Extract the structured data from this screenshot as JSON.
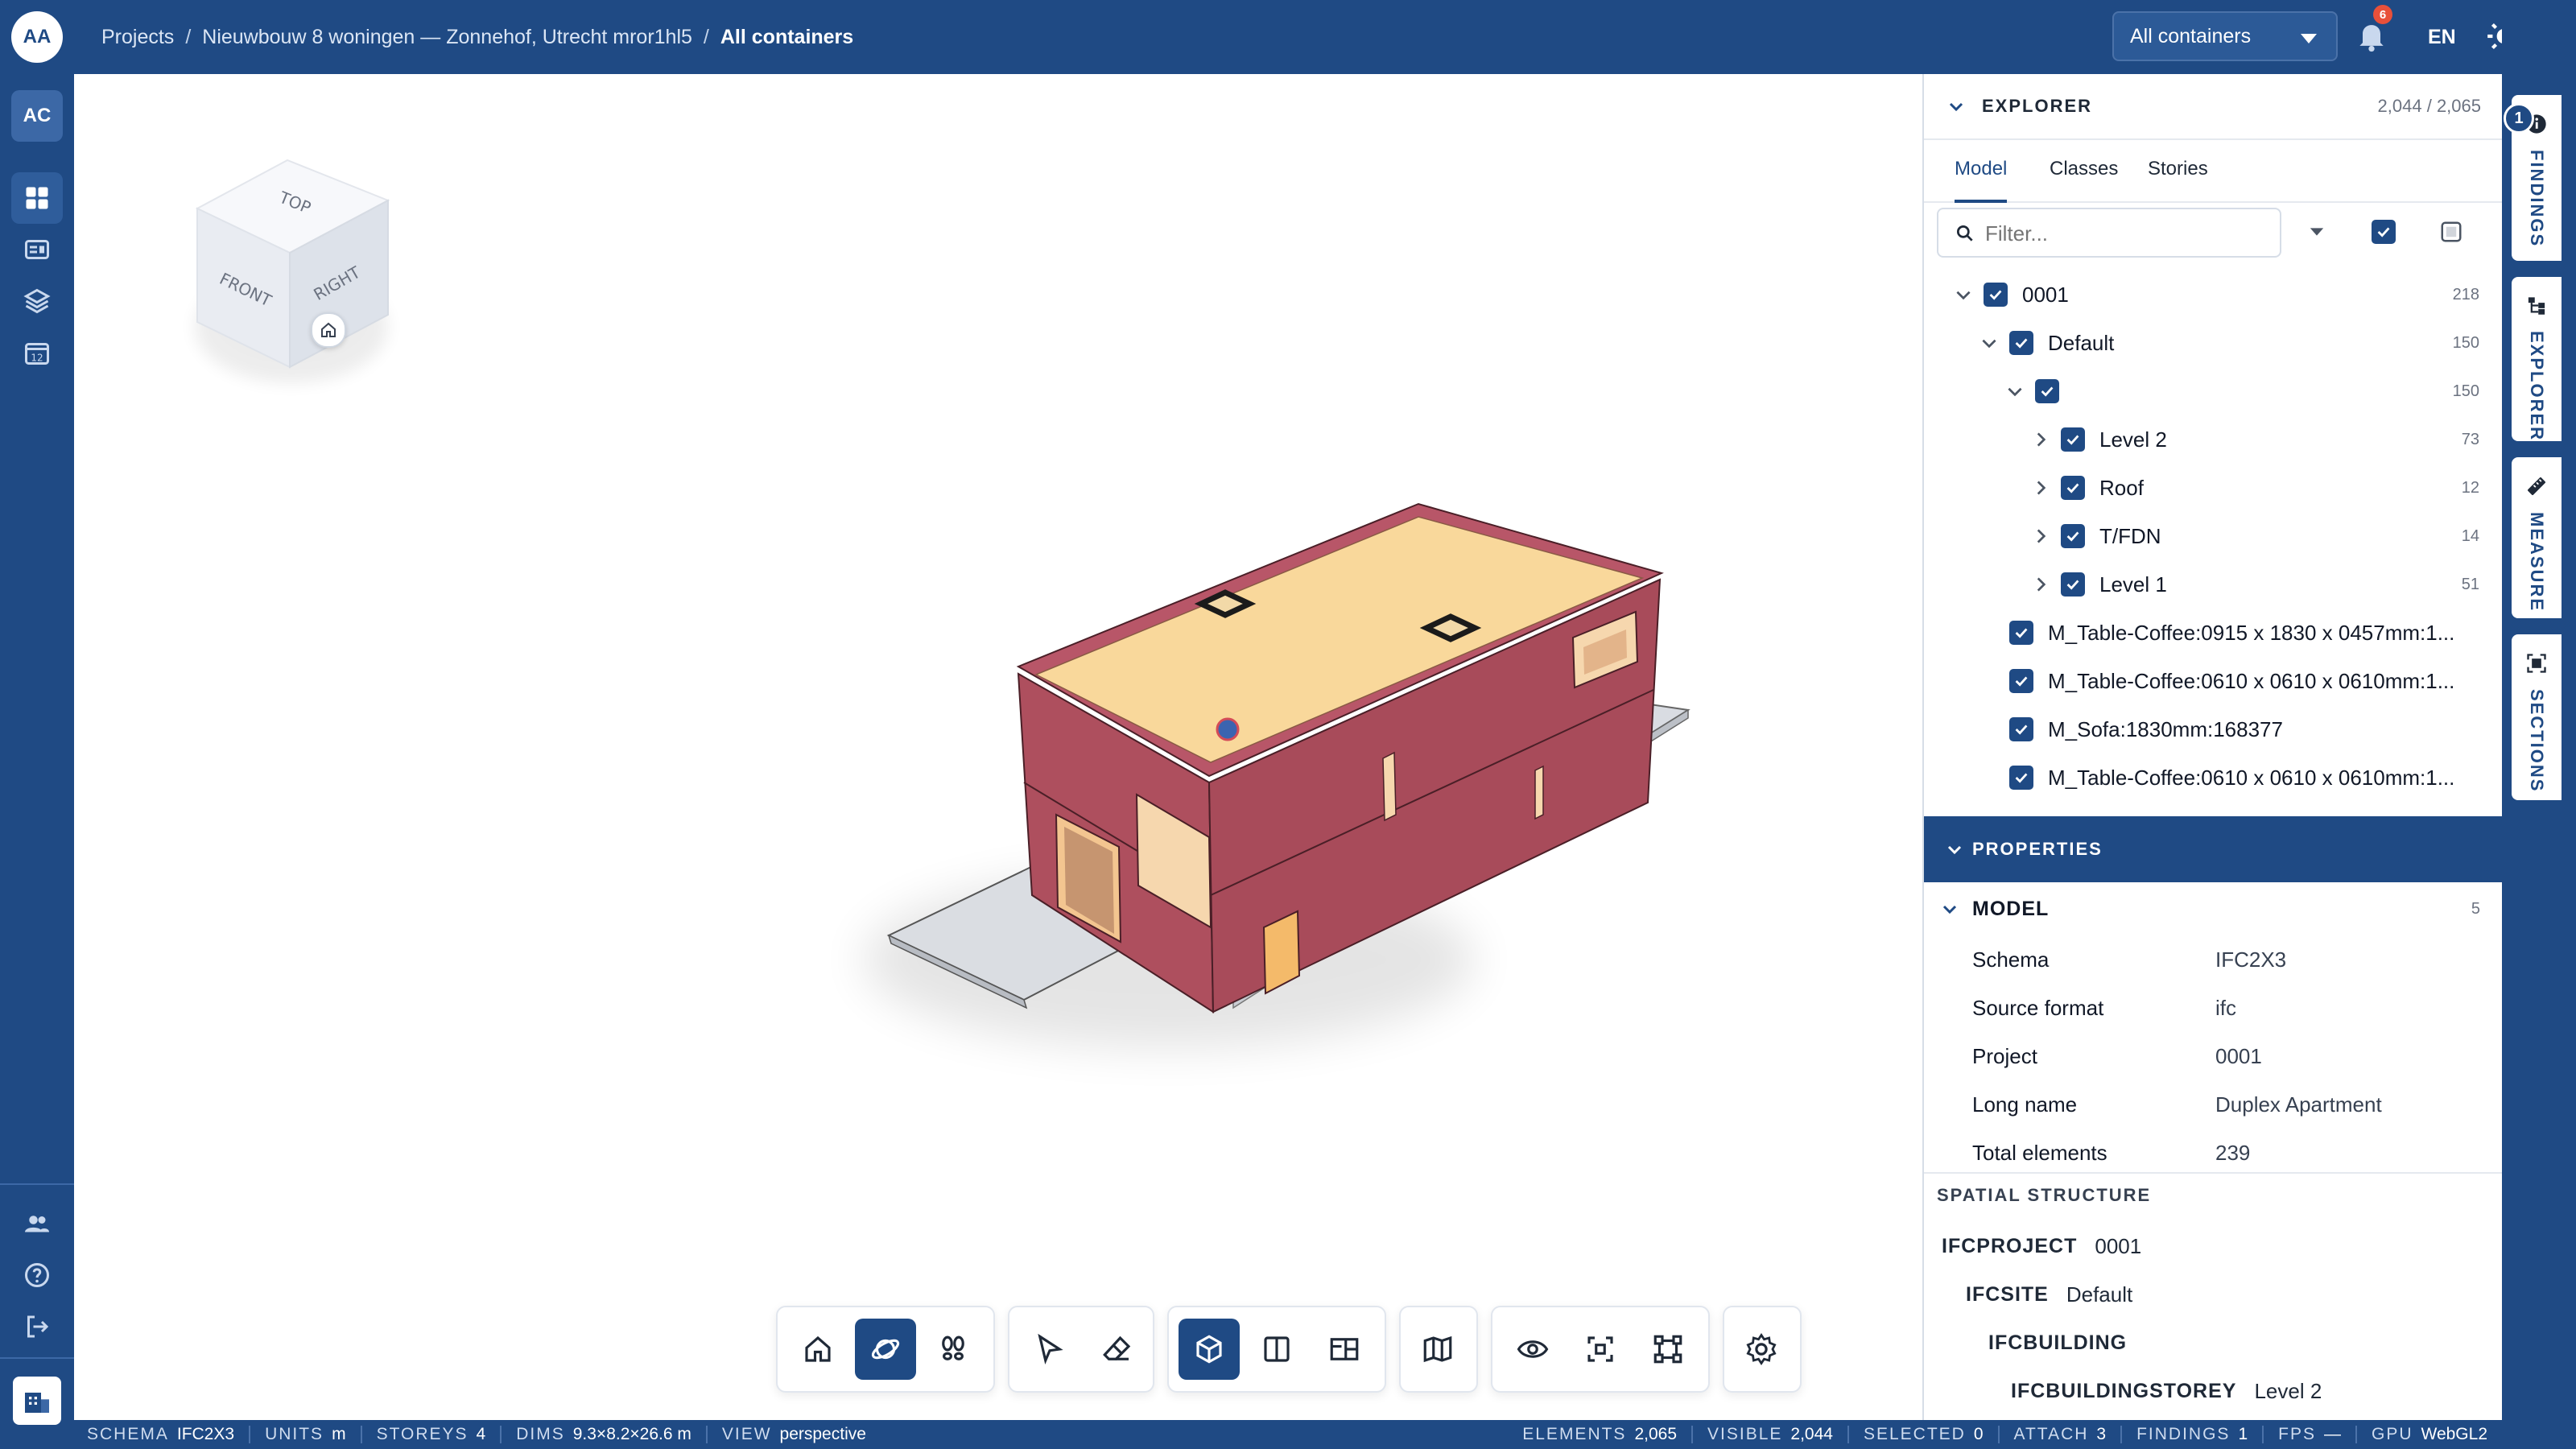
{
  "rail": {
    "avatar": "AA",
    "org": "AC",
    "items": [
      "grid-icon",
      "news-icon",
      "layers-icon",
      "calendar-icon"
    ],
    "calendar_day": "12",
    "bottom": [
      "users-icon",
      "help-icon",
      "logout-icon",
      "building-icon"
    ]
  },
  "header": {
    "breadcrumb": [
      "Projects",
      "Nieuwbouw 8 woningen — Zonnehof, Utrecht mror1hl5",
      "All containers"
    ],
    "separator": "/",
    "container_select": "All containers",
    "notifications": "6",
    "language": "EN"
  },
  "viewcube": {
    "top": "TOP",
    "front": "FRONT",
    "right": "RIGHT"
  },
  "explorer": {
    "title": "EXPLORER",
    "count": "2,044 / 2,065",
    "tabs": [
      "Model",
      "Classes",
      "Stories"
    ],
    "filter_placeholder": "Filter...",
    "tree": [
      {
        "label": "0001",
        "count": "218"
      },
      {
        "label": "Default",
        "count": "150"
      },
      {
        "label": "",
        "count": "150"
      },
      {
        "label": "Level 2",
        "count": "73"
      },
      {
        "label": "Roof",
        "count": "12"
      },
      {
        "label": "T/FDN",
        "count": "14"
      },
      {
        "label": "Level 1",
        "count": "51"
      },
      {
        "label": "M_Table-Coffee:0915 x 1830 x 0457mm:1...",
        "count": ""
      },
      {
        "label": "M_Table-Coffee:0610 x 0610 x 0610mm:1...",
        "count": ""
      },
      {
        "label": "M_Sofa:1830mm:168377",
        "count": ""
      },
      {
        "label": "M_Table-Coffee:0610 x 0610 x 0610mm:1...",
        "count": ""
      }
    ]
  },
  "properties": {
    "title": "PROPERTIES",
    "model_title": "MODEL",
    "model_count": "5",
    "rows": [
      {
        "k": "Schema",
        "v": "IFC2X3"
      },
      {
        "k": "Source format",
        "v": "ifc"
      },
      {
        "k": "Project",
        "v": "0001"
      },
      {
        "k": "Long name",
        "v": "Duplex Apartment"
      },
      {
        "k": "Total elements",
        "v": "239"
      }
    ],
    "spatial_title": "SPATIAL STRUCTURE",
    "spatial": [
      {
        "t": "IFCPROJECT",
        "v": "0001"
      },
      {
        "t": "IFCSITE",
        "v": "Default"
      },
      {
        "t": "IFCBUILDING",
        "v": ""
      },
      {
        "t": "IFCBUILDINGSTOREY",
        "v": "Level 2"
      }
    ]
  },
  "side_tabs": {
    "findings": "FINDINGS",
    "findings_badge": "1",
    "explorer": "EXPLORER",
    "measure": "MEASURE",
    "sections": "SECTIONS"
  },
  "status": {
    "left": [
      {
        "label": "SCHEMA",
        "value": "IFC2X3"
      },
      {
        "label": "UNITS",
        "value": "m"
      },
      {
        "label": "STOREYS",
        "value": "4"
      },
      {
        "label": "DIMS",
        "value": "9.3×8.2×26.6 m"
      },
      {
        "label": "VIEW",
        "value": "perspective"
      }
    ],
    "right": [
      {
        "label": "ELEMENTS",
        "value": "2,065"
      },
      {
        "label": "VISIBLE",
        "value": "2,044"
      },
      {
        "label": "SELECTED",
        "value": "0"
      },
      {
        "label": "ATTACH",
        "value": "3"
      },
      {
        "label": "FINDINGS",
        "value": "1"
      },
      {
        "label": "FPS",
        "value": "—"
      },
      {
        "label": "GPU",
        "value": "WebGL2"
      }
    ]
  },
  "colors": {
    "brand": "#1f4a84",
    "wall": "#b0505f",
    "roof": "#f9d89b"
  }
}
